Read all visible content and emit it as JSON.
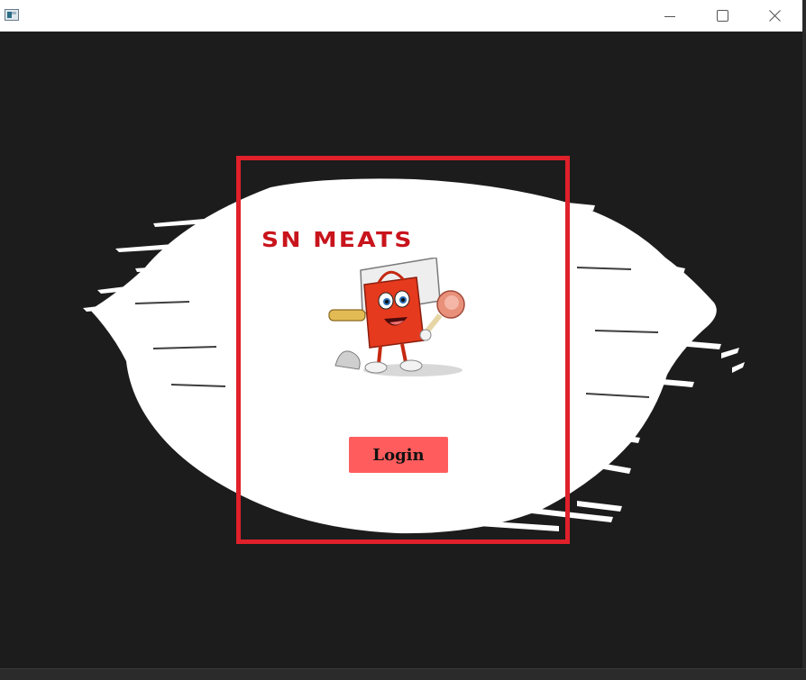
{
  "window": {
    "icon": "app-window-icon",
    "controls": {
      "minimize_icon": "minimize-icon",
      "maximize_icon": "maximize-icon",
      "close_icon": "close-icon"
    }
  },
  "login_card": {
    "brand": "SN MEATS",
    "mascot_icon": "shopping-bag-mascot-icon",
    "login_label": "Login"
  },
  "colors": {
    "background": "#1c1c1c",
    "frame": "#e0202a",
    "brand_text": "#c8141c",
    "login_button": "#ff5d5d",
    "brush": "#ffffff"
  }
}
